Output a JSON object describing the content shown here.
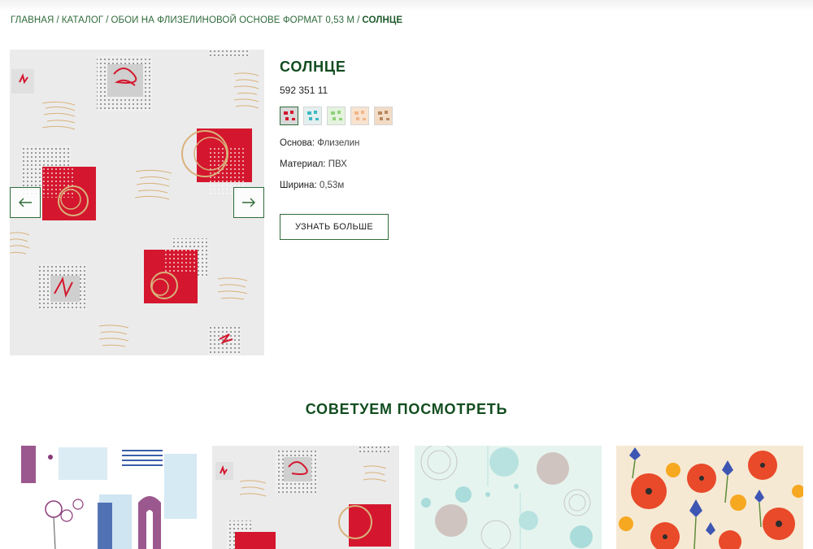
{
  "breadcrumb": {
    "items": [
      "ГЛАВНАЯ",
      "КАТАЛОГ",
      "ОБОИ НА ФЛИЗЕЛИНОВОЙ ОСНОВЕ ФОРМАТ 0,53 М"
    ],
    "current": "СОЛНЦЕ",
    "separator": "/"
  },
  "product": {
    "title": "СОЛНЦЕ",
    "sku": "592 351 11",
    "swatches": [
      {
        "name": "red",
        "color": "#d8d8d8",
        "accent": "#d4172e",
        "active": true
      },
      {
        "name": "turquoise",
        "color": "#e4efef",
        "accent": "#3fb8c4",
        "active": false
      },
      {
        "name": "green",
        "color": "#e4f3de",
        "accent": "#8fd27a",
        "active": false
      },
      {
        "name": "peach",
        "color": "#f7e3cf",
        "accent": "#f3b488",
        "active": false
      },
      {
        "name": "brown",
        "color": "#f2dcc6",
        "accent": "#b88860",
        "active": false
      }
    ],
    "props": [
      {
        "label": "Основа:",
        "value": "Флизелин"
      },
      {
        "label": "Материал:",
        "value": "ПВХ"
      },
      {
        "label": "Ширина:",
        "value": "0,53м"
      }
    ],
    "cta": "УЗНАТЬ БОЛЬШЕ"
  },
  "recommendations": {
    "title": "СОВЕТУЕМ ПОСМОТРЕТЬ",
    "items": [
      {
        "name": "dandelion-pattern"
      },
      {
        "name": "sun-pattern"
      },
      {
        "name": "circles-pattern"
      },
      {
        "name": "poppy-pattern"
      }
    ]
  },
  "colors": {
    "brand_green": "#124d1f",
    "link_green": "#2f6b3a",
    "accent_red": "#d4172e"
  }
}
